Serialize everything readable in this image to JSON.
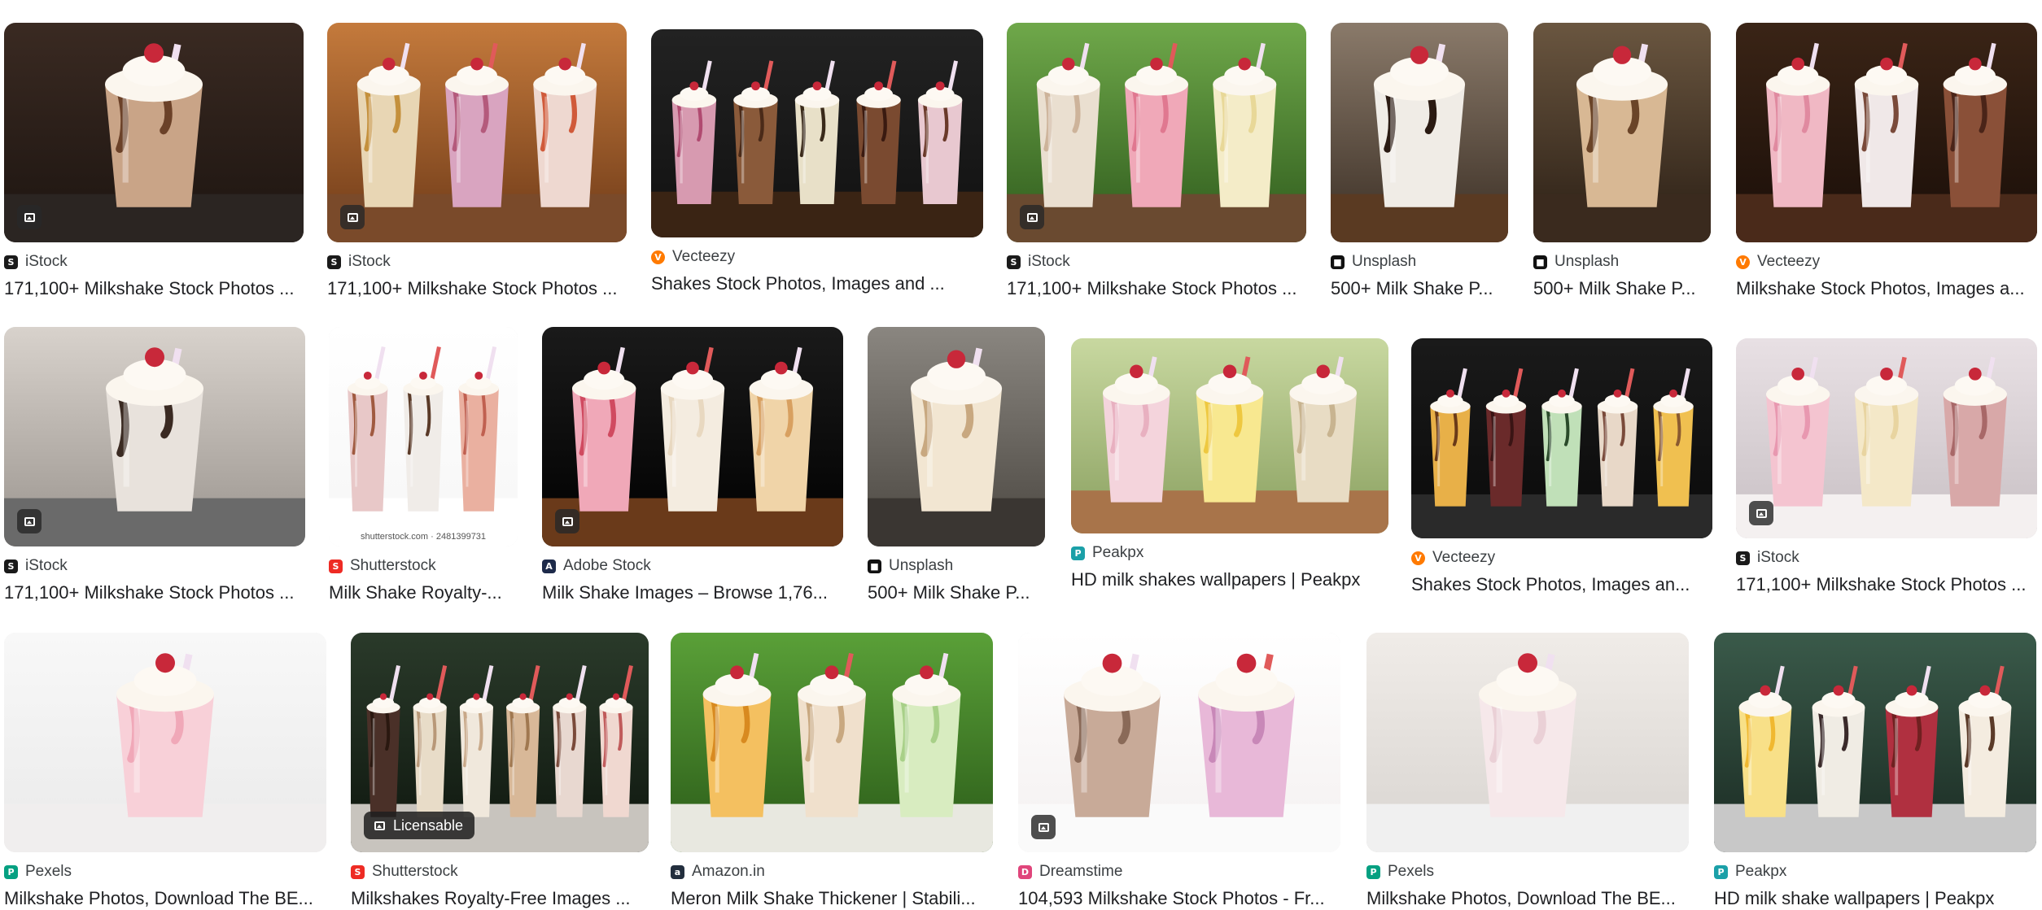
{
  "results": [
    {
      "source": "iStock",
      "favicon": "istock-icon",
      "title": "171,100+ Milkshake Stock Photos ...",
      "badge": "image"
    },
    {
      "source": "iStock",
      "favicon": "istock-icon",
      "title": "171,100+ Milkshake Stock Photos ...",
      "badge": "image"
    },
    {
      "source": "Vecteezy",
      "favicon": "vecteezy-icon",
      "title": "Shakes Stock Photos, Images and ...",
      "badge": ""
    },
    {
      "source": "iStock",
      "favicon": "istock-icon",
      "title": "171,100+ Milkshake Stock Photos ...",
      "badge": "image"
    },
    {
      "source": "Unsplash",
      "favicon": "unsplash-icon",
      "title": "500+ Milk Shake P...",
      "badge": ""
    },
    {
      "source": "Unsplash",
      "favicon": "unsplash-icon",
      "title": "500+ Milk Shake P...",
      "badge": ""
    },
    {
      "source": "Vecteezy",
      "favicon": "vecteezy-icon",
      "title": "Milkshake Stock Photos, Images a...",
      "badge": ""
    },
    {
      "source": "iStock",
      "favicon": "istock-icon",
      "title": "171,100+ Milkshake Stock Photos ...",
      "badge": "image"
    },
    {
      "source": "Shutterstock",
      "favicon": "shutterstock-icon",
      "title": "Milk Shake Royalty-...",
      "badge": "",
      "watermark": "shutterstock.com · 2481399731"
    },
    {
      "source": "Adobe Stock",
      "favicon": "adobe-stock-icon",
      "title": "Milk Shake Images – Browse 1,76...",
      "badge": "image"
    },
    {
      "source": "Unsplash",
      "favicon": "unsplash-icon",
      "title": "500+ Milk Shake P...",
      "badge": ""
    },
    {
      "source": "Peakpx",
      "favicon": "peakpx-icon",
      "title": "HD milk shakes wallpapers | Peakpx",
      "badge": ""
    },
    {
      "source": "Vecteezy",
      "favicon": "vecteezy-icon",
      "title": "Shakes Stock Photos, Images an...",
      "badge": ""
    },
    {
      "source": "iStock",
      "favicon": "istock-icon",
      "title": "171,100+ Milkshake Stock Photos ...",
      "badge": "image"
    },
    {
      "source": "Pexels",
      "favicon": "pexels-icon",
      "title": "Milkshake Photos, Download The BE...",
      "badge": ""
    },
    {
      "source": "Shutterstock",
      "favicon": "shutterstock-icon",
      "title": "Milkshakes Royalty-Free Images ...",
      "badge": "licensable",
      "badge_label": "Licensable"
    },
    {
      "source": "Amazon.in",
      "favicon": "amazon-icon",
      "title": "Meron Milk Shake Thickener | Stabili...",
      "badge": ""
    },
    {
      "source": "Dreamstime",
      "favicon": "dreamstime-icon",
      "title": "104,593 Milkshake Stock Photos - Fr...",
      "badge": "image"
    },
    {
      "source": "Pexels",
      "favicon": "pexels-icon",
      "title": "Milkshake Photos, Download The BE...",
      "badge": ""
    },
    {
      "source": "Peakpx",
      "favicon": "peakpx-icon",
      "title": "HD milk shake wallpapers | Peakpx",
      "badge": ""
    }
  ],
  "colors": {
    "istock": "#1a1a1a",
    "vecteezy": "#ff7a00",
    "unsplash": "#111111",
    "shutterstock": "#ee2b24",
    "adobe": "#1d2a4a",
    "peakpx": "#1ba0a8",
    "pexels": "#05a081",
    "amazon": "#232f3e",
    "dreamstime": "#e0457b"
  }
}
